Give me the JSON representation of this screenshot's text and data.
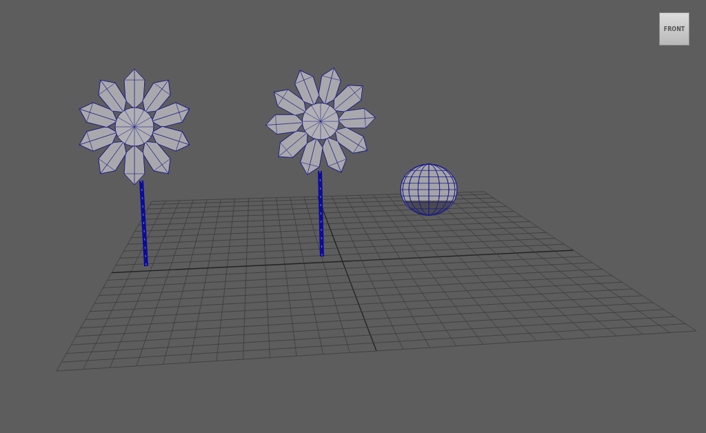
{
  "view_cube": {
    "label": "FRONT"
  }
}
